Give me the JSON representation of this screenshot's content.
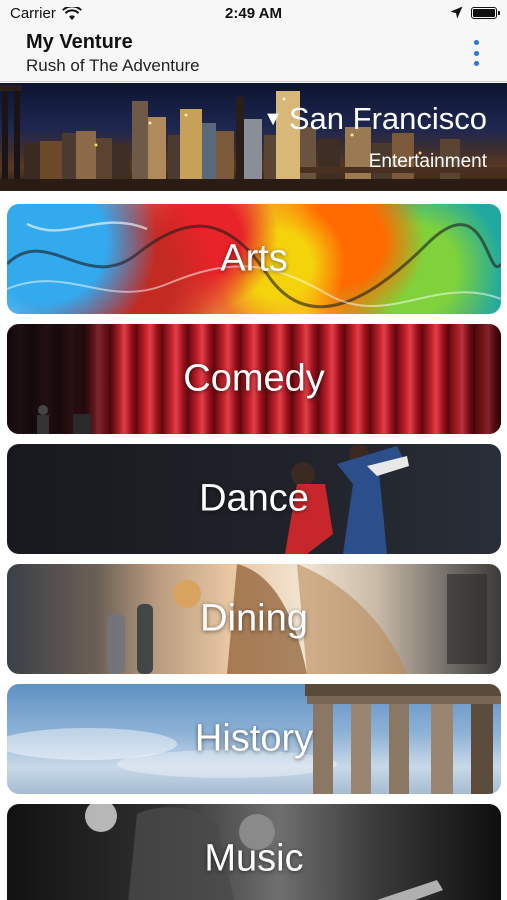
{
  "status_bar": {
    "carrier": "Carrier",
    "time": "2:49 AM"
  },
  "nav": {
    "title": "My Venture",
    "subtitle": "Rush of The Adventure",
    "more_icon": "more-vertical-icon",
    "accent_color": "#1e7ad8"
  },
  "banner": {
    "disclosure_icon": "triangle-down-icon",
    "city": "San Francisco",
    "category": "Entertainment"
  },
  "categories": [
    {
      "label": "Arts"
    },
    {
      "label": "Comedy"
    },
    {
      "label": "Dance"
    },
    {
      "label": "Dining"
    },
    {
      "label": "History"
    },
    {
      "label": "Music"
    }
  ]
}
